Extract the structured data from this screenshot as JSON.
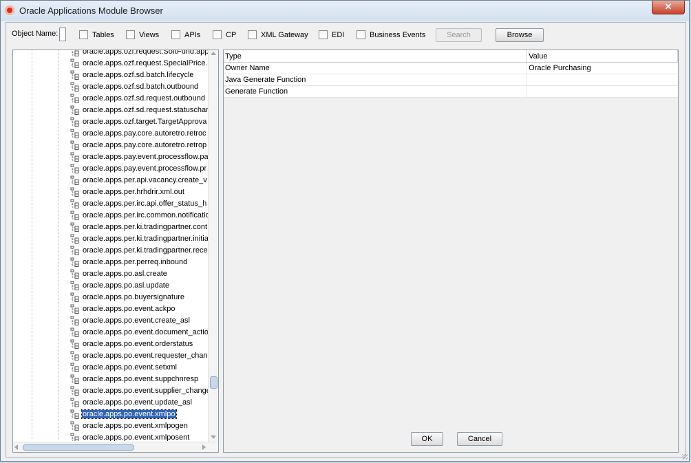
{
  "window": {
    "title": "Oracle Applications Module Browser",
    "close_glyph": "✕"
  },
  "toolbar": {
    "object_name_label": "Object Name:",
    "object_name_value": "",
    "checkboxes": [
      {
        "label": "Tables",
        "checked": false
      },
      {
        "label": "Views",
        "checked": false
      },
      {
        "label": "APIs",
        "checked": false
      },
      {
        "label": "CP",
        "checked": false
      },
      {
        "label": "XML Gateway",
        "checked": false
      },
      {
        "label": "EDI",
        "checked": false
      },
      {
        "label": "Business Events",
        "checked": false
      }
    ],
    "search_label": "Search",
    "browse_label": "Browse"
  },
  "tree": {
    "items": [
      "oracle.apps.ozf.request.SoftFund.app",
      "oracle.apps.ozf.request.SpecialPrice.a",
      "oracle.apps.ozf.sd.batch.lifecycle",
      "oracle.apps.ozf.sd.batch.outbound",
      "oracle.apps.ozf.sd.request.outbound",
      "oracle.apps.ozf.sd.request.statuschar",
      "oracle.apps.ozf.target.TargetApprova",
      "oracle.apps.pay.core.autoretro.retroc",
      "oracle.apps.pay.core.autoretro.retrop",
      "oracle.apps.pay.event.processflow.pa",
      "oracle.apps.pay.event.processflow.pr",
      "oracle.apps.per.api.vacancy.create_v",
      "oracle.apps.per.hrhdrir.xml.out",
      "oracle.apps.per.irc.api.offer_status_h",
      "oracle.apps.per.irc.common.notificatio",
      "oracle.apps.per.ki.tradingpartner.cont",
      "oracle.apps.per.ki.tradingpartner.initia",
      "oracle.apps.per.ki.tradingpartner.rece",
      "oracle.apps.per.perreq.inbound",
      "oracle.apps.po.asl.create",
      "oracle.apps.po.asl.update",
      "oracle.apps.po.buyersignature",
      "oracle.apps.po.event.ackpo",
      "oracle.apps.po.event.create_asl",
      "oracle.apps.po.event.document_actio",
      "oracle.apps.po.event.orderstatus",
      "oracle.apps.po.event.requester_chan",
      "oracle.apps.po.event.setxml",
      "oracle.apps.po.event.suppchnresp",
      "oracle.apps.po.event.supplier_change",
      "oracle.apps.po.event.update_asl",
      "oracle.apps.po.event.xmlpo",
      "oracle.apps.po.event.xmlpogen",
      "oracle.apps.po.event.xmlposent"
    ],
    "selected_item": "oracle.apps.po.event.xmlpo",
    "node_icon": "business-event-node-icon"
  },
  "properties": {
    "columns": [
      "Type",
      "Value"
    ],
    "rows": [
      {
        "type": "Owner Name",
        "value": "Oracle Purchasing"
      },
      {
        "type": "Java Generate Function",
        "value": ""
      },
      {
        "type": "Generate Function",
        "value": ""
      }
    ]
  },
  "footer": {
    "ok_label": "OK",
    "cancel_label": "Cancel"
  },
  "colors": {
    "selection": "#3163b5",
    "titlebar": "#d3e1f0",
    "close": "#c7412d"
  }
}
